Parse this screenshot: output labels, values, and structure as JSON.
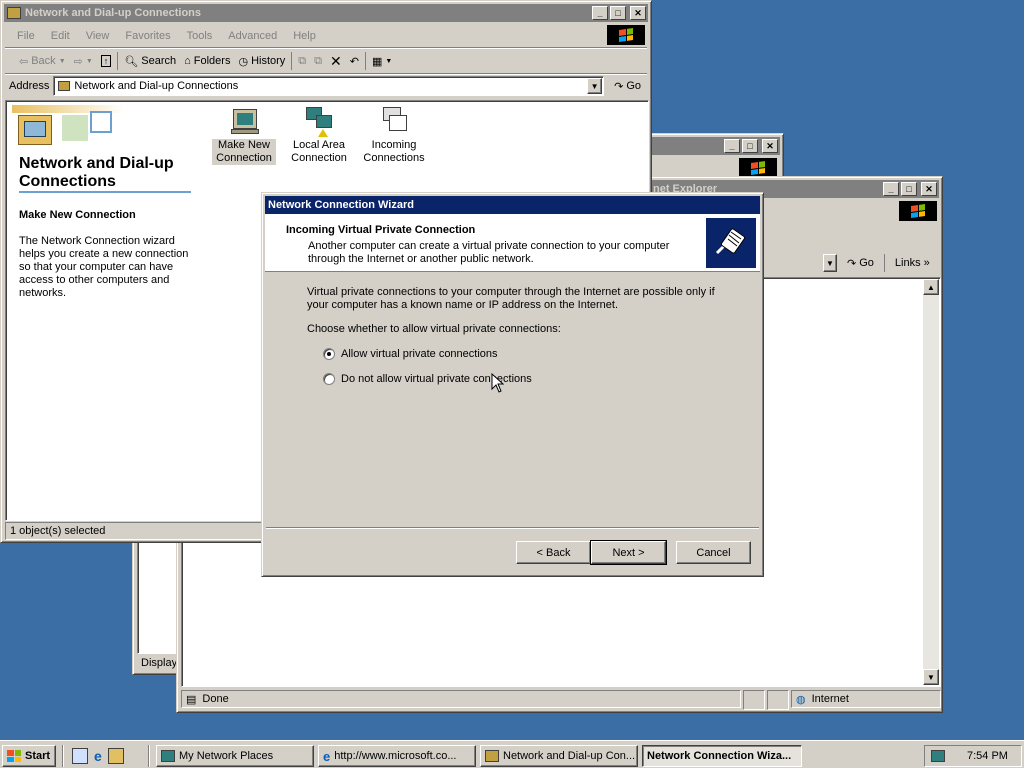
{
  "explorer": {
    "title": "Network and Dial-up Connections",
    "menu": [
      "File",
      "Edit",
      "View",
      "Favorites",
      "Tools",
      "Advanced",
      "Help"
    ],
    "toolbar": {
      "back": "Back",
      "search": "Search",
      "folders": "Folders",
      "history": "History"
    },
    "address_label": "Address",
    "address_value": "Network and Dial-up Connections",
    "go": "Go",
    "heading": "Network and Dial-up Connections",
    "section_title": "Make New Connection",
    "description": "The Network Connection wizard helps you create a new connection so that your computer can have access to other computers and networks.",
    "items": [
      {
        "label": "Make New Connection",
        "icon": "make-new-connection-icon"
      },
      {
        "label": "Local Area Connection",
        "icon": "local-area-connection-icon"
      },
      {
        "label": "Incoming Connections",
        "icon": "incoming-connections-icon"
      }
    ],
    "status": "1 object(s) selected"
  },
  "background_window": {
    "status": "Displays"
  },
  "ie_window": {
    "title_fragment": "net Explorer",
    "go": "Go",
    "links": "Links",
    "status": "Done",
    "zone": "Internet"
  },
  "wizard": {
    "title": "Network Connection Wizard",
    "header_title": "Incoming Virtual Private Connection",
    "header_subtitle": "Another computer can create a virtual private connection to your computer through the Internet or another public network.",
    "info": "Virtual private connections to your computer through the Internet are possible only if your computer has a known name or IP address on the Internet.",
    "prompt": "Choose whether to allow virtual private connections:",
    "options": [
      {
        "label": "Allow virtual private connections",
        "selected": true
      },
      {
        "label": "Do not allow virtual private connections",
        "selected": false
      }
    ],
    "buttons": {
      "back": "< Back",
      "next": "Next >",
      "cancel": "Cancel"
    }
  },
  "taskbar": {
    "start": "Start",
    "tasks": [
      {
        "label": "My Network Places"
      },
      {
        "label": "http://www.microsoft.co..."
      },
      {
        "label": "Network and Dial-up Con..."
      },
      {
        "label": "Network Connection Wiza...",
        "active": true
      }
    ],
    "clock": "7:54 PM"
  },
  "colors": {
    "desktop": "#3a6ea5",
    "active_title": "#0a246a",
    "inactive_title": "#808080",
    "face": "#d4d0c8"
  }
}
